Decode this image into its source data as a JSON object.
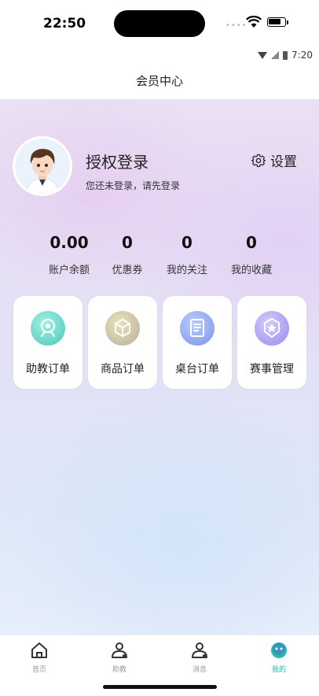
{
  "status": {
    "time": "22:50",
    "secondary_time": "7:20"
  },
  "nav": {
    "title": "会员中心"
  },
  "profile": {
    "login_title": "授权登录",
    "login_subtitle": "您还未登录，请先登录",
    "settings_label": "设置"
  },
  "stats": [
    {
      "value": "0.00",
      "label": "账户余额"
    },
    {
      "value": "0",
      "label": "优惠券"
    },
    {
      "value": "0",
      "label": "我的关注"
    },
    {
      "value": "0",
      "label": "我的收藏"
    }
  ],
  "cards": [
    {
      "label": "助教订单",
      "icon": "assistant-order-icon",
      "color": "#63d2c5"
    },
    {
      "label": "商品订单",
      "icon": "goods-order-icon",
      "color": "#c8c08e"
    },
    {
      "label": "桌台订单",
      "icon": "table-order-icon",
      "color": "#8fa9f0"
    },
    {
      "label": "赛事管理",
      "icon": "match-manage-icon",
      "color": "#a79ff0"
    }
  ],
  "tabbar": [
    {
      "label": "首页",
      "icon": "home-icon"
    },
    {
      "label": "助教",
      "icon": "assistant-icon"
    },
    {
      "label": "消息",
      "icon": "message-icon"
    },
    {
      "label": "我的",
      "icon": "profile-icon",
      "active": true
    }
  ],
  "colors": {
    "accent": "#2fb8a6"
  }
}
